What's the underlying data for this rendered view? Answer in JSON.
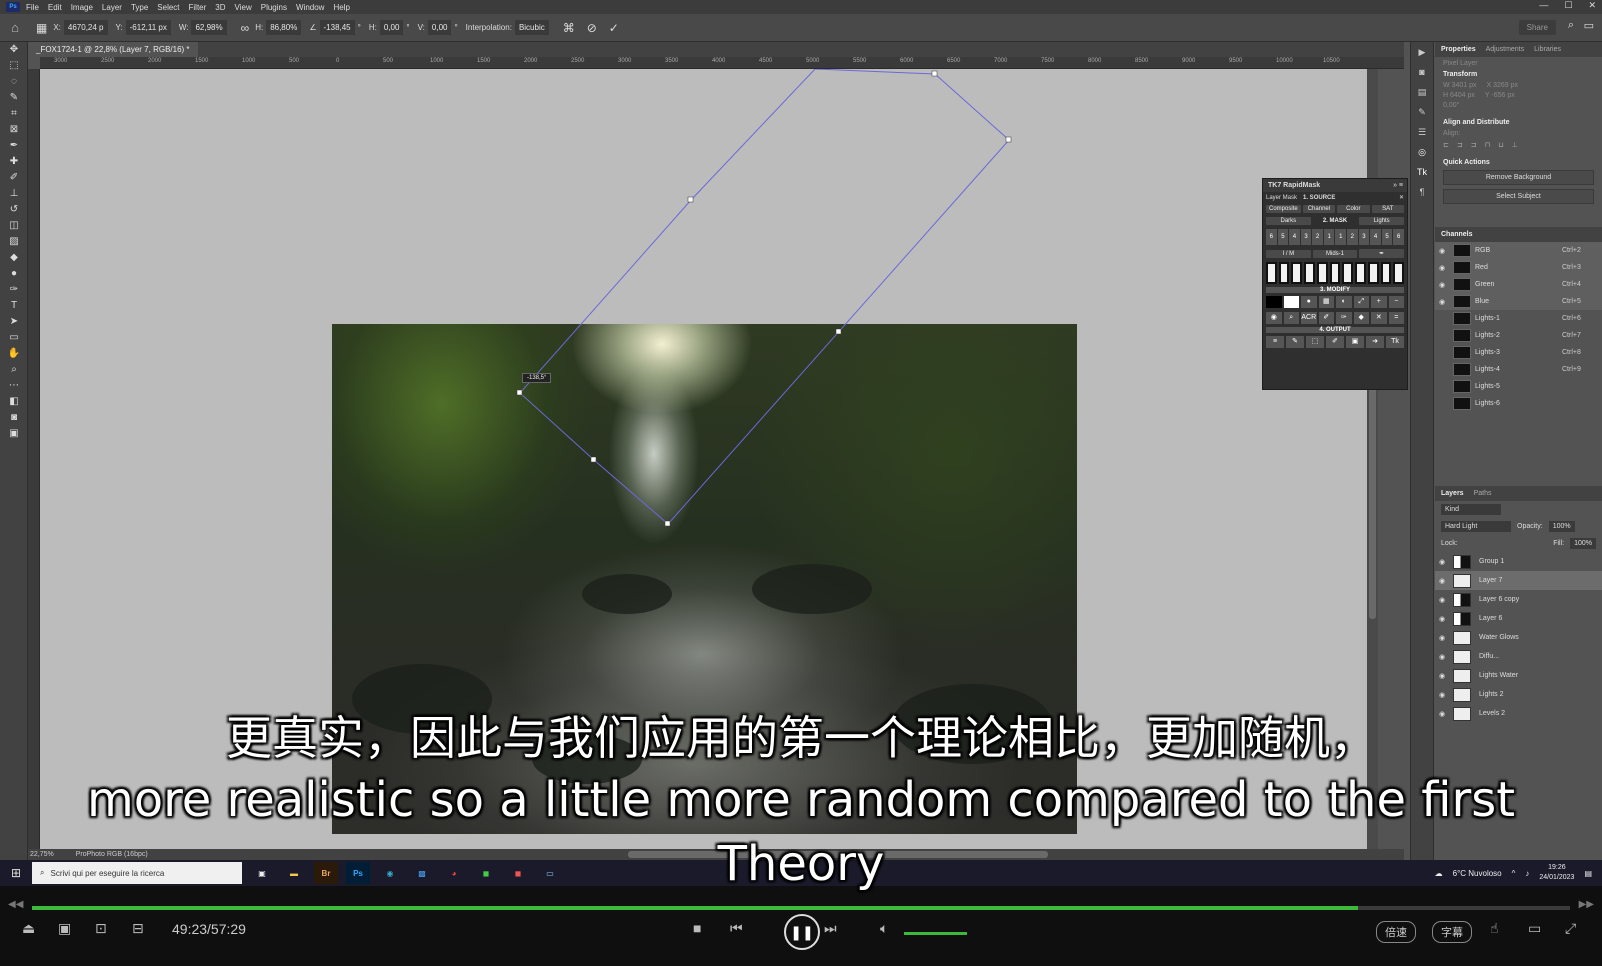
{
  "photoshop": {
    "menus": [
      "File",
      "Edit",
      "Image",
      "Layer",
      "Type",
      "Select",
      "Filter",
      "3D",
      "View",
      "Plugins",
      "Window",
      "Help"
    ],
    "options": {
      "x_label": "X:",
      "x": "4670,24 p",
      "y_label": "Y:",
      "y": "-612,11 px",
      "w_label": "W:",
      "w": "62,98%",
      "h_label": "H:",
      "h": "86,80%",
      "angle": "-138,45",
      "hskew_label": "H:",
      "hskew": "0,00",
      "vskew_label": "V:",
      "vskew": "0,00",
      "interp_label": "Interpolation:",
      "interp": "Bicubic",
      "share_label": "Share"
    },
    "doc_tab": "_FOX1724-1 @ 22,8% (Layer 7, RGB/16) *",
    "ruler_labels": [
      "3000",
      "2500",
      "2000",
      "1500",
      "1000",
      "500",
      "0",
      "500",
      "1000",
      "1500",
      "2000",
      "2500",
      "3000",
      "3500",
      "4000",
      "4500",
      "5000",
      "5500",
      "6000",
      "6500",
      "7000",
      "7500",
      "8000",
      "8500",
      "9000",
      "9500",
      "10000",
      "10500"
    ],
    "angle_tooltip": "-138,5°",
    "status_zoom": "22,75%",
    "status_profile": "ProPhoto RGB (16bpc)",
    "rapidmask": {
      "title": "TK7 RapidMask",
      "layer_mask": "Layer Mask",
      "source": "1. SOURCE",
      "source_buttons": [
        "Composite",
        "Channel",
        "Color",
        "SAT"
      ],
      "darks": "Darks",
      "mask": "2. MASK",
      "lights": "Lights",
      "cells": [
        "6",
        "5",
        "4",
        "3",
        "2",
        "1",
        "1",
        "2",
        "3",
        "4",
        "5",
        "6"
      ],
      "im": "I / M",
      "mids": "Mids-1",
      "modify": "3. MODIFY",
      "acr": "ACR",
      "output": "4. OUTPUT"
    },
    "properties": {
      "tabs": [
        "Properties",
        "Adjustments",
        "Libraries"
      ],
      "pixel_layer": "Pixel Layer",
      "transform": "Transform",
      "w": "W  3401 px",
      "h": "H  6404 px",
      "x": "X  3269 px",
      "y": "Y  -656 px",
      "angle": "0,00°",
      "align": "Align and Distribute",
      "align_sub": "Align:",
      "quick": "Quick Actions",
      "remove_bg": "Remove Background",
      "select_subject": "Select Subject"
    },
    "channels": {
      "title": "Channels",
      "rows": [
        {
          "name": "RGB",
          "shortcut": "Ctrl+2"
        },
        {
          "name": "Red",
          "shortcut": "Ctrl+3"
        },
        {
          "name": "Green",
          "shortcut": "Ctrl+4"
        },
        {
          "name": "Blue",
          "shortcut": "Ctrl+5"
        },
        {
          "name": "Lights-1",
          "shortcut": "Ctrl+6"
        },
        {
          "name": "Lights-2",
          "shortcut": "Ctrl+7"
        },
        {
          "name": "Lights-3",
          "shortcut": "Ctrl+8"
        },
        {
          "name": "Lights-4",
          "shortcut": "Ctrl+9"
        },
        {
          "name": "Lights-5",
          "shortcut": ""
        },
        {
          "name": "Lights-6",
          "shortcut": ""
        }
      ]
    },
    "layers": {
      "tabs": [
        "Layers",
        "Paths"
      ],
      "kind": "Kind",
      "blend": "Hard Light",
      "opacity_label": "Opacity:",
      "opacity": "100%",
      "lock_label": "Lock:",
      "fill_label": "Fill:",
      "fill": "100%",
      "rows": [
        {
          "name": "Group 1"
        },
        {
          "name": "Layer 7"
        },
        {
          "name": "Layer 6 copy"
        },
        {
          "name": "Layer 6"
        },
        {
          "name": "Water Glows"
        },
        {
          "name": "Diffu..."
        },
        {
          "name": "Lights Water"
        },
        {
          "name": "Lights 2"
        },
        {
          "name": "Levels 2"
        }
      ]
    }
  },
  "taskbar": {
    "search_placeholder": "Scrivi qui per eseguire la ricerca",
    "apps": [
      "Br",
      "Ps"
    ],
    "weather": "6°C  Nuvoloso",
    "time": "19:26",
    "date": "24/01/2023"
  },
  "player": {
    "time": "49:23/57:29",
    "progress": 0.862,
    "volume": 0.45,
    "speed_label": "倍速",
    "subtitle_label": "字幕"
  },
  "subtitles": {
    "zh": "更真实，因此与我们应用的第一个理论相比，更加随机，",
    "en1": "more realistic so a little more random compared to the first",
    "en2": "Theory"
  }
}
